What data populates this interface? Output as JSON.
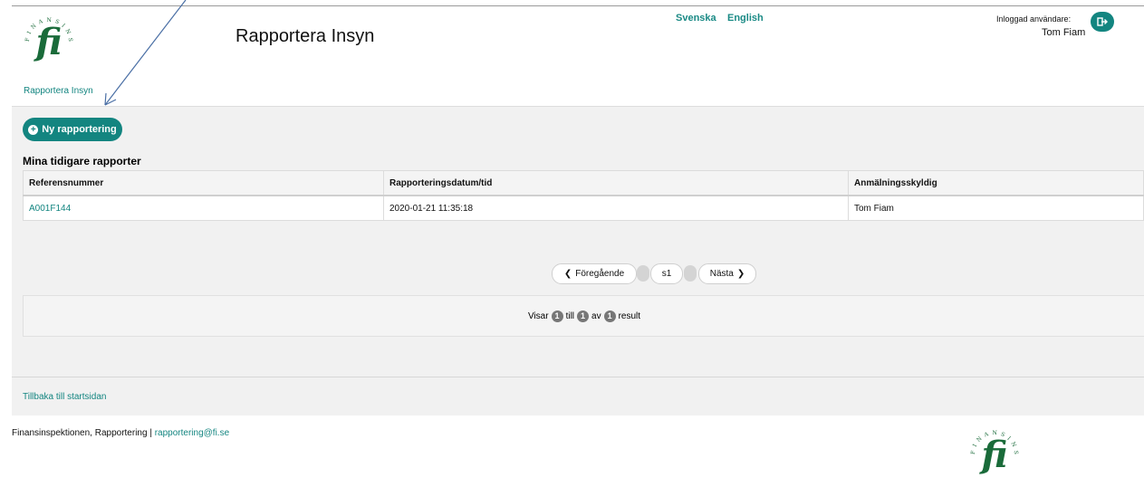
{
  "header": {
    "app_title": "Rapportera Insyn",
    "languages": [
      "Svenska",
      "English"
    ],
    "user_label": "Inloggad användare:",
    "user_name": "Tom Fiam"
  },
  "breadcrumb": {
    "label": "Rapportera Insyn"
  },
  "toolbar": {
    "new_report_label": "Ny rapportering"
  },
  "reports": {
    "title": "Mina tidigare rapporter",
    "columns": [
      "Referensnummer",
      "Rapporteringsdatum/tid",
      "Anmälningsskyldig"
    ],
    "rows": [
      {
        "ref": "A001F144",
        "date": "2020-01-21 11:35:18",
        "person": "Tom Fiam"
      }
    ]
  },
  "pagination": {
    "prev_label": "Föregående",
    "page_label": "s1",
    "next_label": "Nästa"
  },
  "summary": {
    "visar": "Visar",
    "from": "1",
    "till": "till",
    "to": "1",
    "av": "av",
    "total": "1",
    "result": "result"
  },
  "back_link": "Tillbaka till startsidan",
  "footer": {
    "org": "Finansinspektionen, Rapportering",
    "separator": "|",
    "email": "rapportering@fi.se"
  },
  "colors": {
    "accent": "#138580",
    "panel": "#f1f1f1"
  }
}
